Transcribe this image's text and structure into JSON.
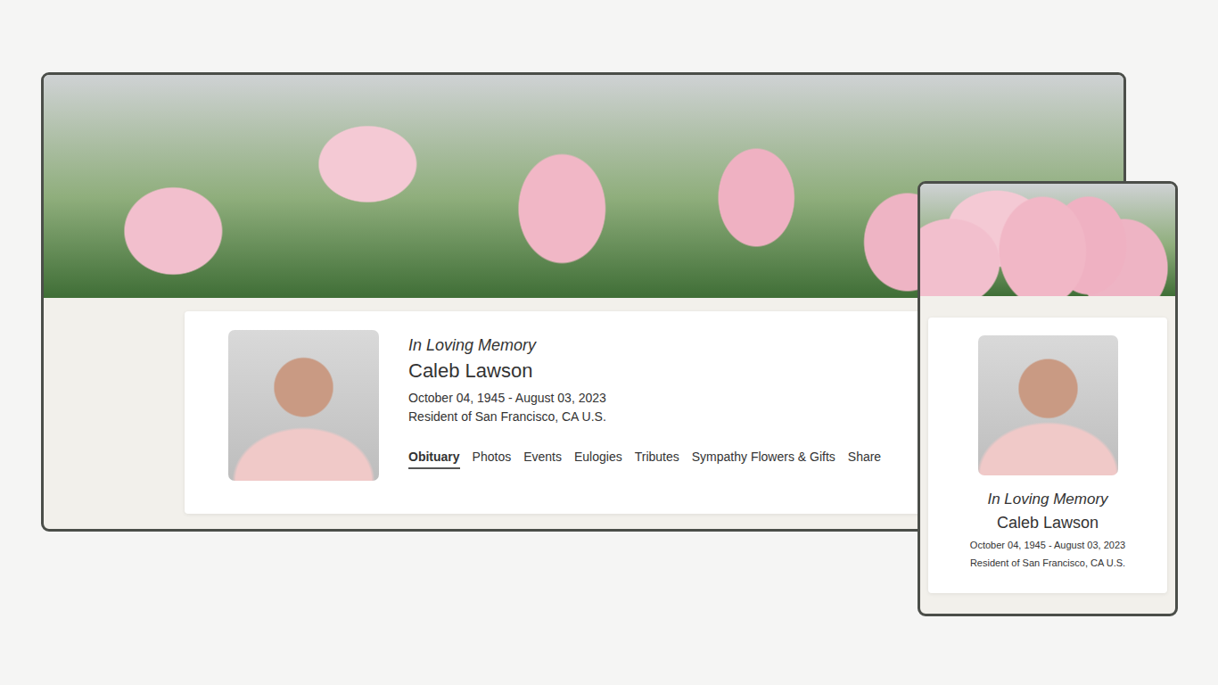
{
  "memorial": {
    "heading": "In Loving Memory",
    "name": "Caleb Lawson",
    "dates": "October 04, 1945 - August 03, 2023",
    "residence": "Resident of San Francisco, CA U.S."
  },
  "tabs": [
    {
      "label": "Obituary",
      "selected": true
    },
    {
      "label": "Photos",
      "selected": false
    },
    {
      "label": "Events",
      "selected": false
    },
    {
      "label": "Eulogies",
      "selected": false
    },
    {
      "label": "Tributes",
      "selected": false
    },
    {
      "label": "Sympathy Flowers & Gifts",
      "selected": false
    },
    {
      "label": "Share",
      "selected": false
    }
  ]
}
